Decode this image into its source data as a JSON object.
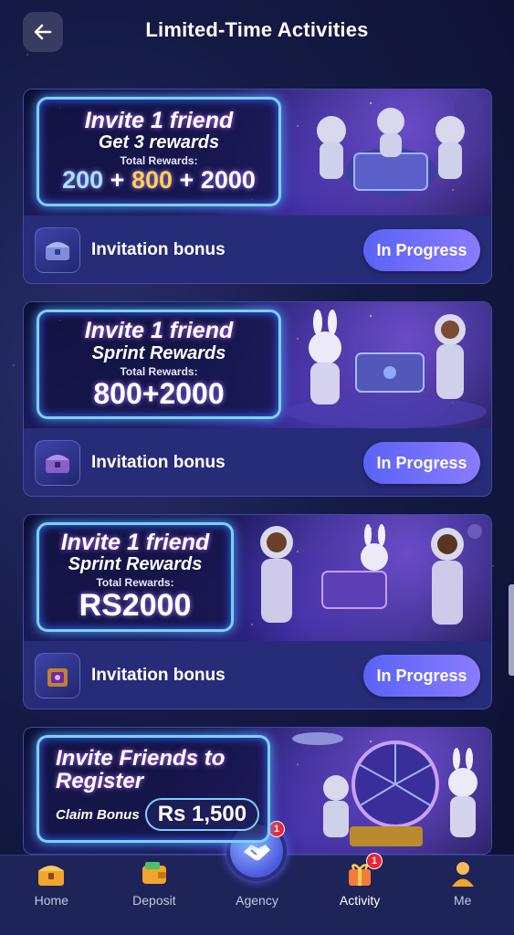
{
  "header": {
    "title": "Limited-Time Activities"
  },
  "cards": [
    {
      "promo": {
        "line1": "Invite 1 friend",
        "line2": "Get 3 rewards",
        "small": "Total Rewards:",
        "amount_a": "200",
        "amount_plus1": "+",
        "amount_b": "800",
        "amount_plus2": "+",
        "amount_c": "2000"
      },
      "title": "Invitation bonus",
      "status": "In Progress"
    },
    {
      "promo": {
        "line1": "Invite 1 friend",
        "line2": "Sprint Rewards",
        "small": "Total Rewards:",
        "amount": "800+2000"
      },
      "title": "Invitation bonus",
      "status": "In Progress"
    },
    {
      "promo": {
        "line1": "Invite 1 friend",
        "line2": "Sprint Rewards",
        "small": "Total Rewards:",
        "amount": "RS2000"
      },
      "title": "Invitation bonus",
      "status": "In Progress"
    },
    {
      "promo": {
        "line1": "Invite Friends to",
        "line2": "Register",
        "claim_label": "Claim Bonus",
        "claim_amount": "Rs 1,500"
      }
    }
  ],
  "nav": {
    "items": [
      {
        "label": "Home",
        "icon": "home-chest-icon"
      },
      {
        "label": "Deposit",
        "icon": "wallet-icon"
      },
      {
        "label": "Agency",
        "icon": "handshake-icon",
        "badge": "1"
      },
      {
        "label": "Activity",
        "icon": "gift-icon",
        "badge": "1"
      },
      {
        "label": "Me",
        "icon": "user-icon"
      }
    ]
  },
  "colors": {
    "accent": "#6a6ff8",
    "badge": "#f0242f",
    "card": "#272c78"
  }
}
